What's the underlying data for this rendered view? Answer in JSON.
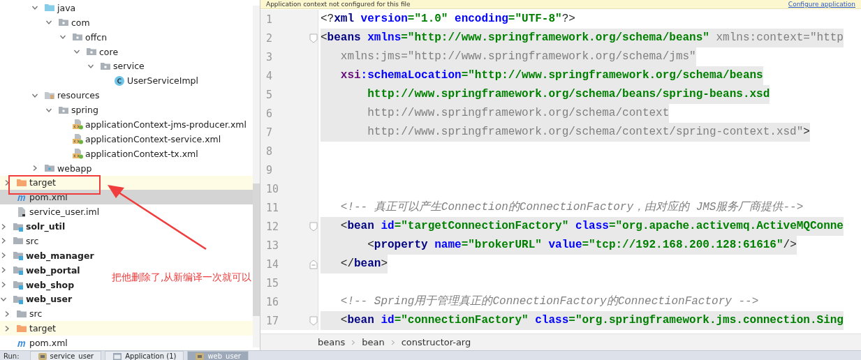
{
  "project_tree": {
    "items": [
      {
        "children": [
          {
            "children": [
              {
                "children": [
                  {
                    "label": "java",
                    "kind": "source-folder",
                    "expanded": true,
                    "children": [
                      {
                        "label": "com",
                        "kind": "package",
                        "expanded": true,
                        "children": [
                          {
                            "label": "offcn",
                            "kind": "package",
                            "expanded": true,
                            "children": [
                              {
                                "label": "core",
                                "kind": "package",
                                "expanded": true,
                                "children": [
                                  {
                                    "label": "service",
                                    "kind": "package",
                                    "expanded": true,
                                    "children": [
                                      {
                                        "label": "UserServiceImpl",
                                        "kind": "class"
                                      }
                                    ]
                                  }
                                ]
                              }
                            ]
                          }
                        ]
                      }
                    ]
                  },
                  {
                    "label": "resources",
                    "kind": "resources-folder",
                    "expanded": true,
                    "children": [
                      {
                        "label": "spring",
                        "kind": "package",
                        "expanded": true,
                        "children": [
                          {
                            "label": "applicationContext-jms-producer.xml",
                            "kind": "spring-xml"
                          },
                          {
                            "label": "applicationContext-service.xml",
                            "kind": "spring-xml"
                          },
                          {
                            "label": "applicationContext-tx.xml",
                            "kind": "spring-xml"
                          }
                        ]
                      }
                    ]
                  },
                  {
                    "label": "webapp",
                    "kind": "web-folder",
                    "expanded": false
                  }
                ]
              }
            ]
          },
          {
            "label": "target",
            "kind": "excluded-folder",
            "expanded": false,
            "excluded": true
          },
          {
            "label": "pom.xml",
            "kind": "maven",
            "selected": true
          },
          {
            "label": "service_user.iml",
            "kind": "iml"
          }
        ]
      },
      {
        "label": "solr_util",
        "kind": "module",
        "expanded": false,
        "module": true
      },
      {
        "label": "src",
        "kind": "folder",
        "expanded": false
      },
      {
        "label": "web_manager",
        "kind": "module",
        "expanded": false,
        "module": true
      },
      {
        "label": "web_portal",
        "kind": "module",
        "expanded": false,
        "module": true
      },
      {
        "label": "web_shop",
        "kind": "module",
        "expanded": false,
        "module": true
      },
      {
        "label": "web_user",
        "kind": "module",
        "expanded": true,
        "module": true,
        "children": [
          {
            "label": "src",
            "kind": "folder",
            "expanded": false
          },
          {
            "label": "target",
            "kind": "excluded-folder",
            "expanded": false,
            "excluded": true
          },
          {
            "label": "pom.xml",
            "kind": "maven",
            "selected": false
          }
        ]
      }
    ]
  },
  "annotation": {
    "text": "把他删除了,从新编译一次就可以"
  },
  "editor": {
    "banner": {
      "message": "Application context not configured for this file",
      "link": "Configure application"
    },
    "lines": [
      {
        "number": "1",
        "highlighted": false,
        "tokens": [
          {
            "kind": "punct",
            "text": "<?"
          },
          {
            "kind": "tag",
            "text": "xml "
          },
          {
            "kind": "attr",
            "text": "version"
          },
          {
            "kind": "value",
            "text": "=\"1.0\" "
          },
          {
            "kind": "attr",
            "text": "encoding"
          },
          {
            "kind": "value",
            "text": "=\"UTF-8\""
          },
          {
            "kind": "punct",
            "text": "?>"
          }
        ]
      },
      {
        "number": "2",
        "highlighted": true,
        "fold_start": true,
        "tokens": [
          {
            "kind": "punct",
            "text": "<"
          },
          {
            "kind": "tag",
            "text": "beans "
          },
          {
            "kind": "attr",
            "text": "xmlns"
          },
          {
            "kind": "value",
            "text": "=\"http://www.springframework.org/schema/beans\" "
          },
          {
            "kind": "unused",
            "text": "xmlns:context=\"http"
          }
        ]
      },
      {
        "number": "3",
        "highlighted": true,
        "tokens": [
          {
            "kind": "unused",
            "text": "   xmlns:jms=\"http://www.springframework.org/schema/jms\""
          }
        ]
      },
      {
        "number": "4",
        "highlighted": true,
        "tokens": [
          {
            "kind": "ns",
            "text": "   xsi"
          },
          {
            "kind": "attr",
            "text": ":schemaLocation"
          },
          {
            "kind": "value",
            "text": "=\"http://www.springframework.org/schema/beans"
          }
        ]
      },
      {
        "number": "5",
        "highlighted": true,
        "tokens": [
          {
            "kind": "value",
            "text": "       http://www.springframework.org/schema/beans/spring-beans.xsd"
          }
        ]
      },
      {
        "number": "6",
        "highlighted": true,
        "tokens": [
          {
            "kind": "unused",
            "text": "       http://www.springframework.org/schema/context"
          }
        ]
      },
      {
        "number": "7",
        "highlighted": true,
        "tokens": [
          {
            "kind": "unused",
            "text": "       http://www.springframework.org/schema/context/spring-context.xsd\""
          },
          {
            "kind": "punct",
            "text": ">"
          }
        ]
      },
      {
        "number": "8"
      },
      {
        "number": "9"
      },
      {
        "number": "10"
      },
      {
        "number": "11",
        "highlighted": false,
        "tokens": [
          {
            "kind": "comment",
            "text": "   <!-- 真正可以产生Connection的ConnectionFactory，由对应的 JMS服务厂商提供-->"
          }
        ]
      },
      {
        "number": "12",
        "highlighted": true,
        "fold_start": true,
        "tokens": [
          {
            "kind": "punct",
            "text": "   <"
          },
          {
            "kind": "tag",
            "text": "bean "
          },
          {
            "kind": "attr",
            "text": "id"
          },
          {
            "kind": "value",
            "text": "=\"targetConnectionFactory\" "
          },
          {
            "kind": "attr",
            "text": "class"
          },
          {
            "kind": "value",
            "text": "=\"org.apache.activemq.ActiveMQConne"
          }
        ]
      },
      {
        "number": "13",
        "highlighted": true,
        "tokens": [
          {
            "kind": "punct",
            "text": "       <"
          },
          {
            "kind": "tag",
            "text": "property "
          },
          {
            "kind": "attr",
            "text": "name"
          },
          {
            "kind": "value",
            "text": "=\"brokerURL\" "
          },
          {
            "kind": "attr",
            "text": "value"
          },
          {
            "kind": "value",
            "text": "=\"tcp://192.168.200.128:61616\""
          },
          {
            "kind": "punct",
            "text": "/>"
          }
        ]
      },
      {
        "number": "14",
        "highlighted": true,
        "fold_end": true,
        "tokens": [
          {
            "kind": "punct",
            "text": "   </"
          },
          {
            "kind": "tag",
            "text": "bean"
          },
          {
            "kind": "punct",
            "text": ">"
          }
        ]
      },
      {
        "number": "15"
      },
      {
        "number": "16",
        "highlighted": false,
        "tokens": [
          {
            "kind": "comment",
            "text": "   <!-- Spring用于管理真正的ConnectionFactory的ConnectionFactory -->"
          }
        ]
      },
      {
        "number": "17",
        "highlighted": true,
        "fold_start": true,
        "tokens": [
          {
            "kind": "punct",
            "text": "   <"
          },
          {
            "kind": "tag",
            "text": "bean "
          },
          {
            "kind": "attr",
            "text": "id"
          },
          {
            "kind": "value",
            "text": "=\"connectionFactory\" "
          },
          {
            "kind": "attr",
            "text": "class"
          },
          {
            "kind": "value",
            "text": "=\"org.springframework.jms.connection.Sing"
          }
        ]
      }
    ],
    "breadcrumbs": [
      "beans",
      "bean",
      "constructor-arg"
    ]
  },
  "run_bar": {
    "label": "Run:",
    "tabs": [
      {
        "label": "service_user",
        "kind": "app",
        "selected": false
      },
      {
        "label": "Application (1)",
        "kind": "window",
        "selected": false
      },
      {
        "label": "web_user",
        "kind": "app",
        "selected": true
      }
    ]
  }
}
